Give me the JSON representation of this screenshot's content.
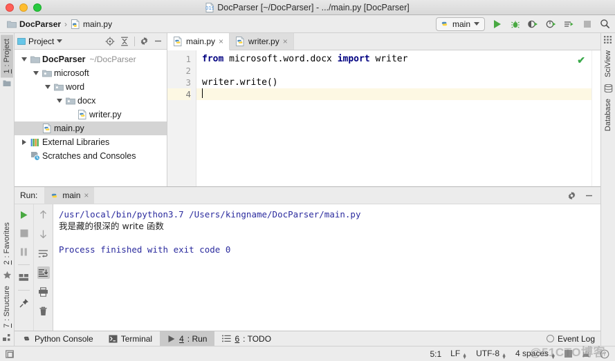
{
  "window": {
    "title": "DocParser [~/DocParser] - .../main.py [DocParser]",
    "traffic": {
      "close": "close-window",
      "minimize": "minimize-window",
      "maximize": "maximize-window"
    }
  },
  "breadcrumb": {
    "project": "DocParser",
    "separator": "›",
    "file": "main.py"
  },
  "toolbar": {
    "run_config": "main",
    "icons": [
      "run-icon",
      "debug-icon",
      "run-coverage-icon",
      "profile-icon",
      "run-with-console-icon",
      "stop-icon",
      "search-icon"
    ]
  },
  "left_strip": {
    "top": [
      {
        "num": "1",
        "label": ": Project",
        "active": true
      }
    ],
    "bottom": [
      {
        "num": "2",
        "label": ": Favorites",
        "active": false
      },
      {
        "num": "7",
        "label": ": Structure",
        "active": false
      }
    ]
  },
  "right_strip": {
    "items": [
      "SciView",
      "Database"
    ]
  },
  "project_panel": {
    "title": "Project",
    "header_icons": [
      "locate-icon",
      "collapse-all-icon",
      "settings-icon",
      "hide-icon"
    ],
    "tree": [
      {
        "indent": 0,
        "arrow": "down",
        "icon": "folder-icon",
        "label": "DocParser",
        "bold": true,
        "sub": "~/DocParser",
        "selected": false
      },
      {
        "indent": 1,
        "arrow": "down",
        "icon": "package-icon",
        "label": "microsoft",
        "bold": false,
        "sub": "",
        "selected": false
      },
      {
        "indent": 2,
        "arrow": "down",
        "icon": "package-icon",
        "label": "word",
        "bold": false,
        "sub": "",
        "selected": false
      },
      {
        "indent": 3,
        "arrow": "down",
        "icon": "package-icon",
        "label": "docx",
        "bold": false,
        "sub": "",
        "selected": false
      },
      {
        "indent": 4,
        "arrow": "none",
        "icon": "python-file-icon",
        "label": "writer.py",
        "bold": false,
        "sub": "",
        "selected": false
      },
      {
        "indent": 1,
        "arrow": "none",
        "icon": "python-file-icon",
        "label": "main.py",
        "bold": false,
        "sub": "",
        "selected": true
      },
      {
        "indent": 0,
        "arrow": "right",
        "icon": "libraries-icon",
        "label": "External Libraries",
        "bold": false,
        "sub": "",
        "selected": false
      },
      {
        "indent": 0,
        "arrow": "none",
        "icon": "scratches-icon",
        "label": "Scratches and Consoles",
        "bold": false,
        "sub": "",
        "selected": false
      }
    ]
  },
  "editor": {
    "tabs": [
      {
        "label": "main.py",
        "active": true,
        "close": "×"
      },
      {
        "label": "writer.py",
        "active": false,
        "close": "×"
      }
    ],
    "gutter": [
      "1",
      "2",
      "3",
      "4"
    ],
    "current_line": 4,
    "inspection_status": "✔",
    "lines": [
      {
        "n": 1,
        "parts": [
          {
            "t": "from",
            "k": true
          },
          {
            "t": " microsoft.word.docx ",
            "k": false
          },
          {
            "t": "import",
            "k": true
          },
          {
            "t": " writer",
            "k": false
          }
        ]
      },
      {
        "n": 2,
        "parts": [
          {
            "t": "",
            "k": false
          }
        ]
      },
      {
        "n": 3,
        "parts": [
          {
            "t": "writer.write()",
            "k": false
          }
        ]
      },
      {
        "n": 4,
        "parts": [
          {
            "t": "",
            "k": false
          }
        ]
      }
    ]
  },
  "run_window": {
    "label": "Run:",
    "tab": "main",
    "tab_close": "×",
    "header_icons": [
      "settings-icon",
      "hide-icon"
    ],
    "side_icons_left": [
      "rerun-icon",
      "stop-icon",
      "pause-icon",
      "restore-layout-icon",
      "pin-icon"
    ],
    "side_icons_right": [
      "up-icon",
      "down-icon",
      "soft-wrap-icon",
      "scroll-to-end-icon",
      "print-icon",
      "trash-icon"
    ],
    "console": [
      {
        "text": "/usr/local/bin/python3.7 /Users/kingname/DocParser/main.py",
        "style": "cmd"
      },
      {
        "text": "我是藏的很深的 write 函数",
        "style": "out"
      },
      {
        "text": "",
        "style": "out"
      },
      {
        "text": "Process finished with exit code 0",
        "style": "cmd"
      }
    ]
  },
  "bottom_bar": {
    "tabs": [
      {
        "icon": "python-console-icon",
        "num": "",
        "label": "Python Console",
        "active": false
      },
      {
        "icon": "terminal-icon",
        "num": "",
        "label": "Terminal",
        "active": false
      },
      {
        "icon": "run-icon",
        "num": "4",
        "label": ": Run",
        "active": true
      },
      {
        "icon": "todo-icon",
        "num": "6",
        "label": ": TODO",
        "active": false
      }
    ],
    "event_log": "Event Log"
  },
  "status_bar": {
    "caret": "5:1",
    "line_separator": "LF",
    "encoding": "UTF-8",
    "indent": "4 spaces"
  },
  "watermark": "@51CTO博客",
  "colors": {
    "accent_green": "#3aa94a",
    "keyword_blue": "#000080",
    "console_blue": "#2b2b9e",
    "selection_gray": "#d4d4d4",
    "current_line": "#fdf8e3"
  }
}
